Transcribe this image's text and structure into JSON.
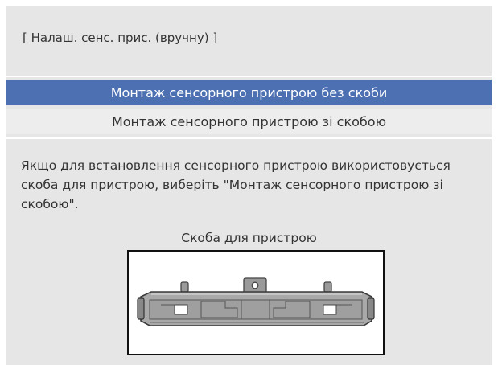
{
  "header": {
    "title": "[ Налаш. сенс. прис. (вручну) ]"
  },
  "menu": {
    "items": [
      {
        "label": "Монтаж сенсорного пристрою без скоби",
        "selected": true
      },
      {
        "label": "Монтаж сенсорного пристрою зі скобою",
        "selected": false
      }
    ]
  },
  "description": "Якщо для встановлення сенсорного пристрою використовується скоба для пристрою, виберіть \"Монтаж сенсорного пристрою зі скобою\".",
  "figure": {
    "caption": "Скоба для пристрою",
    "image": "bracket-illustration"
  },
  "colors": {
    "panel_bg": "#e6e6e6",
    "selected_bg": "#4d70b3",
    "selected_text": "#ffffff",
    "text": "#333333"
  }
}
